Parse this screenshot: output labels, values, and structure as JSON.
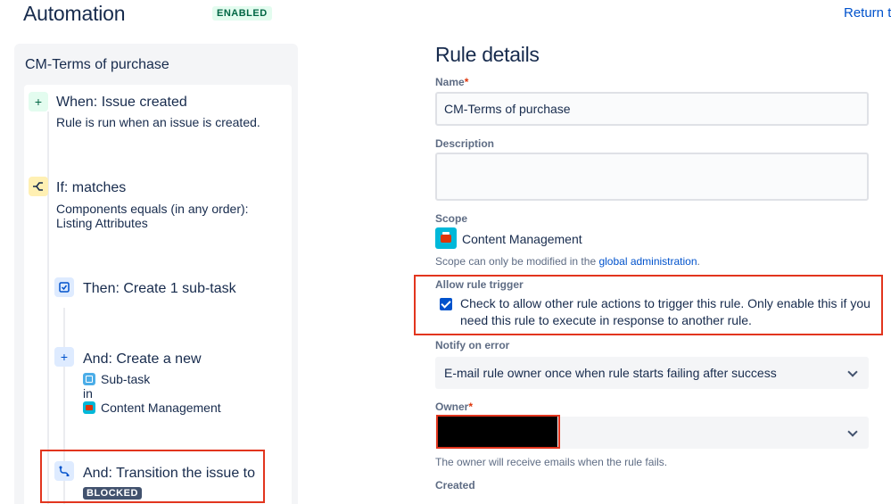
{
  "header": {
    "title": "Automation",
    "status_badge": "ENABLED",
    "return_link": "Return t"
  },
  "rule": {
    "name": "CM-Terms of purchase",
    "steps": [
      {
        "icon": "plus-icon",
        "title": "When: Issue created",
        "desc": "Rule is run when an issue is created."
      },
      {
        "icon": "branch-icon",
        "title": "If: matches",
        "desc_line1": "Components equals (in any order):",
        "desc_line2": "Listing Attributes"
      },
      {
        "icon": "subtask-checklist-icon",
        "title": "Then: Create 1 sub-task"
      },
      {
        "icon": "plus-icon",
        "title": "And: Create a new",
        "issue_type": "Sub-task",
        "in_label": "in",
        "project": "Content Management"
      },
      {
        "icon": "transition-icon",
        "title": "And: Transition the issue to",
        "status": "BLOCKED"
      }
    ]
  },
  "details": {
    "title": "Rule details",
    "name_label": "Name",
    "name_value": "CM-Terms of purchase",
    "required_mark": "*",
    "description_label": "Description",
    "description_value": "",
    "scope_label": "Scope",
    "scope_value": "Content Management",
    "scope_helper_prefix": "Scope can only be modified in the ",
    "scope_helper_link": "global administration",
    "scope_helper_suffix": ".",
    "allow_trigger_label": "Allow rule trigger",
    "allow_trigger_text": "Check to allow other rule actions to trigger this rule. Only enable this if you need this rule to execute in response to another rule.",
    "allow_trigger_checked": true,
    "notify_label": "Notify on error",
    "notify_value": "E-mail rule owner once when rule starts failing after success",
    "owner_label": "Owner",
    "owner_helper": "The owner will receive emails when the rule fails.",
    "created_label": "Created"
  },
  "colors": {
    "accent": "#0052cc",
    "highlight_box": "#e2351e",
    "enabled_bg": "#e3fcef",
    "enabled_text": "#006644"
  }
}
